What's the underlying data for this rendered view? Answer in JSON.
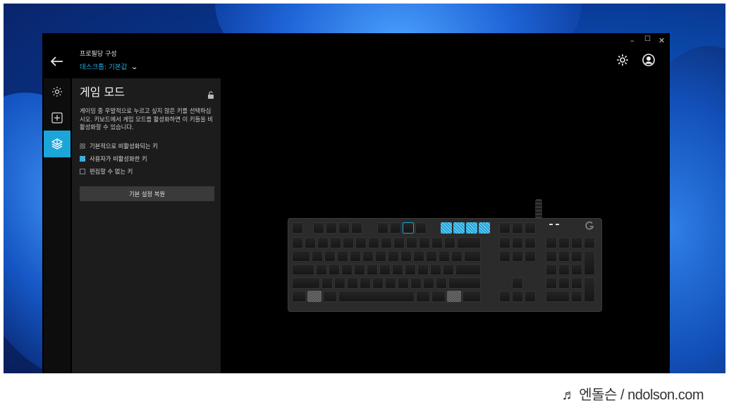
{
  "header": {
    "title": "프로필당 구성",
    "profile": "데스크톱: 기본값"
  },
  "window_controls": {
    "minimize": "–",
    "maximize": "☐",
    "close": "✕"
  },
  "panel": {
    "title": "게임 모드",
    "description": "게이밍 중 우발적으로 누르고 싶지 않은 키를 선택하십시오. 키보드에서 게임 모드를 활성화하면 이 키들을 비활성화할 수 있습니다.",
    "legend": [
      {
        "label": "기본적으로 비활성화되는 키",
        "kind": "def"
      },
      {
        "label": "사용자가 비활성화한 키",
        "kind": "user"
      },
      {
        "label": "편집할 수 없는 키",
        "kind": "none"
      }
    ],
    "reset_label": "기본 설정 복원"
  },
  "colors": {
    "accent": "#1ba5d9",
    "panel": "#1c1c1c",
    "background": "#000000"
  },
  "icons": [
    "back-arrow-icon",
    "chevron-down-icon",
    "settings-gear-icon",
    "account-icon",
    "brightness-icon",
    "add-icon",
    "game-mode-icon",
    "lock-open-icon",
    "logitech-g-logo"
  ],
  "watermark": "♬ 엔돌슨 / ndolson.com"
}
